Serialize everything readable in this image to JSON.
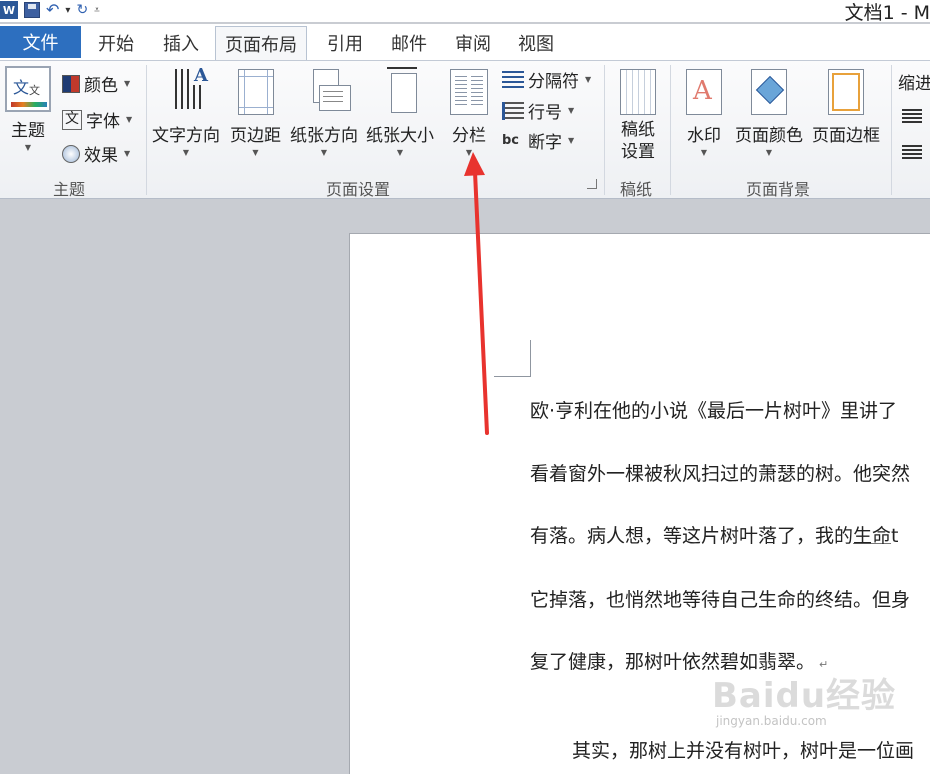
{
  "titlebar": {
    "app_icon": "word-icon",
    "app_letter": "W",
    "doc_title": "文档1 - M"
  },
  "tabs": {
    "file": "文件",
    "items": [
      "开始",
      "插入",
      "页面布局",
      "引用",
      "邮件",
      "审阅",
      "视图"
    ],
    "active": "页面布局"
  },
  "ribbon": {
    "theme_group": {
      "label": "主题",
      "theme_button": "主题",
      "colors": "颜色",
      "fonts": "字体",
      "effects": "效果"
    },
    "page_setup_group": {
      "label": "页面设置",
      "text_direction": "文字方向",
      "margins": "页边距",
      "orientation": "纸张方向",
      "size": "纸张大小",
      "columns": "分栏",
      "breaks": "分隔符",
      "line_numbers": "行号",
      "hyphenation": "断字"
    },
    "manuscript_group": {
      "label": "稿纸",
      "setup_line1": "稿纸",
      "setup_line2": "设置"
    },
    "page_background_group": {
      "label": "页面背景",
      "watermark": "水印",
      "page_color": "页面颜色",
      "page_borders": "页面边框"
    },
    "paragraph_group": {
      "indent": "缩进"
    }
  },
  "document": {
    "lines": [
      "欧·亨利在他的小说《最后一片树叶》里讲了",
      "看着窗外一棵被秋风扫过的萧瑟的树。他突然",
      "有落。病人想，等这片树叶落了，我的",
      "它掉落，也悄然地等待自己生命的终结。但身",
      "复了健康，那树叶依然碧如翡翠。",
      "其实，那树上并没有树叶，树叶是一位画"
    ],
    "line3_underlined": "生命",
    "line3_tail": "t",
    "pilcrow": "↵"
  },
  "watermark": {
    "brand": "Baidu经验",
    "url": "jingyan.baidu.com"
  },
  "colors": {
    "file_tab": "#2d6fbf",
    "annotation_arrow": "#e8332e"
  }
}
